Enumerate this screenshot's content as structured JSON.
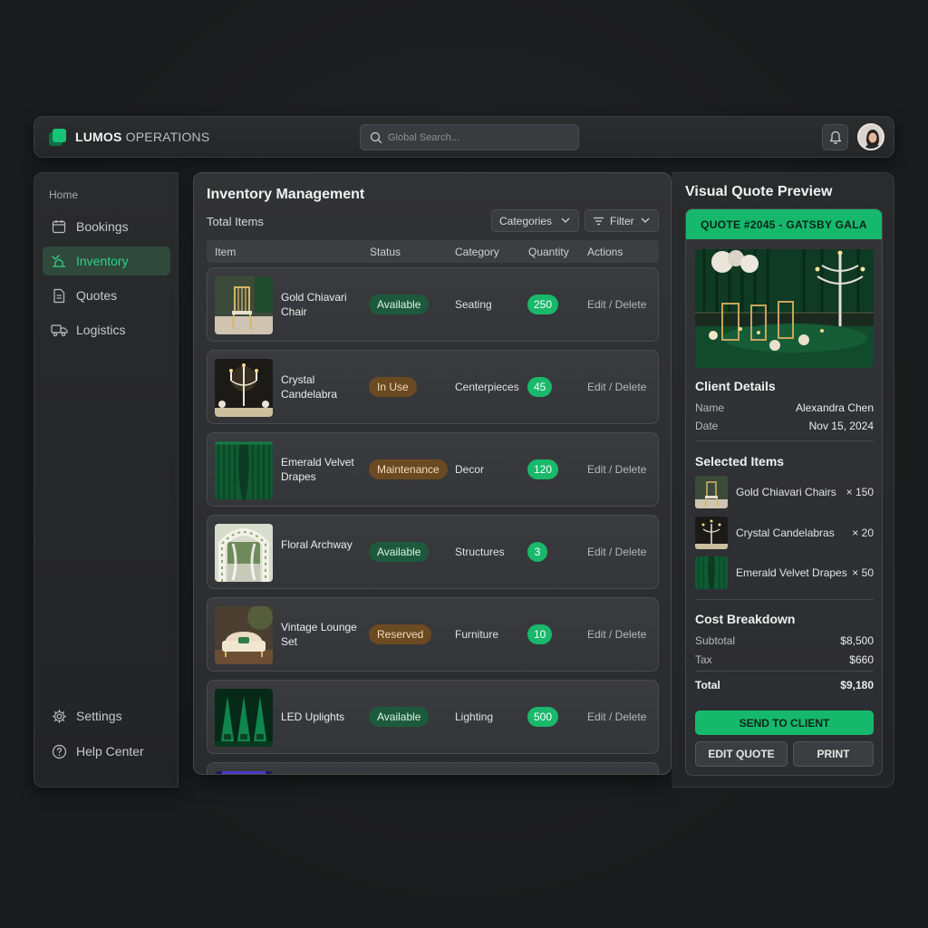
{
  "app": {
    "brand_primary": "LUMOS",
    "brand_secondary": "OPERATIONS",
    "accent_color": "#18c377"
  },
  "search": {
    "placeholder": "Global Search..."
  },
  "sidebar": {
    "home_label": "Home",
    "items": [
      {
        "label": "Bookings",
        "icon": "calendar-icon"
      },
      {
        "label": "Inventory",
        "icon": "inventory-icon",
        "active": true
      },
      {
        "label": "Quotes",
        "icon": "document-icon"
      },
      {
        "label": "Logistics",
        "icon": "truck-icon"
      }
    ],
    "footer": [
      {
        "label": "Settings",
        "icon": "gear-icon"
      },
      {
        "label": "Help Center",
        "icon": "help-icon"
      }
    ]
  },
  "inventory": {
    "title": "Inventory Management",
    "total_label": "Total Items",
    "categories_label": "Categories",
    "filter_label": "Filter",
    "columns": [
      "Item",
      "Status",
      "Category",
      "Quantity",
      "Actions"
    ],
    "rows": [
      {
        "name": "Gold Chiavari Chair",
        "status": "Available",
        "category": "Seating",
        "quantity": "250",
        "actions": "Edit / Delete"
      },
      {
        "name": "Crystal Candelabra",
        "status": "In Use",
        "category": "Centerpieces",
        "quantity": "45",
        "actions": "Edit / Delete"
      },
      {
        "name": "Emerald Velvet Drapes",
        "status": "Maintenance",
        "category": "Decor",
        "quantity": "120",
        "actions": "Edit / Delete"
      },
      {
        "name": "Floral Archway",
        "status": "Available",
        "category": "Structures",
        "quantity": "3",
        "actions": "Edit / Delete"
      },
      {
        "name": "Vintage Lounge Set",
        "status": "Reserved",
        "category": "Furniture",
        "quantity": "10",
        "actions": "Edit / Delete"
      },
      {
        "name": "LED Uplights",
        "status": "Available",
        "category": "Lighting",
        "quantity": "500",
        "actions": "Edit / Delete"
      }
    ]
  },
  "quote": {
    "panel_title": "Visual Quote Preview",
    "header": "QUOTE #2045 - GATSBY GALA",
    "client_title": "Client Details",
    "name_label": "Name",
    "name_value": "Alexandra Chen",
    "date_label": "Date",
    "date_value": "Nov 15, 2024",
    "selected_title": "Selected Items",
    "selected_items": [
      {
        "name": "Gold Chiavari Chairs",
        "qty": "× 150"
      },
      {
        "name": "Crystal Candelabras",
        "qty": "× 20"
      },
      {
        "name": "Emerald Velvet Drapes",
        "qty": "× 50"
      }
    ],
    "cost_title": "Cost Breakdown",
    "subtotal_label": "Subtotal",
    "subtotal_value": "$8,500",
    "tax_label": "Tax",
    "tax_value": "$660",
    "total_label": "Total",
    "total_value": "$9,180",
    "send_label": "SEND TO CLIENT",
    "edit_label": "EDIT QUOTE",
    "print_label": "PRINT"
  }
}
